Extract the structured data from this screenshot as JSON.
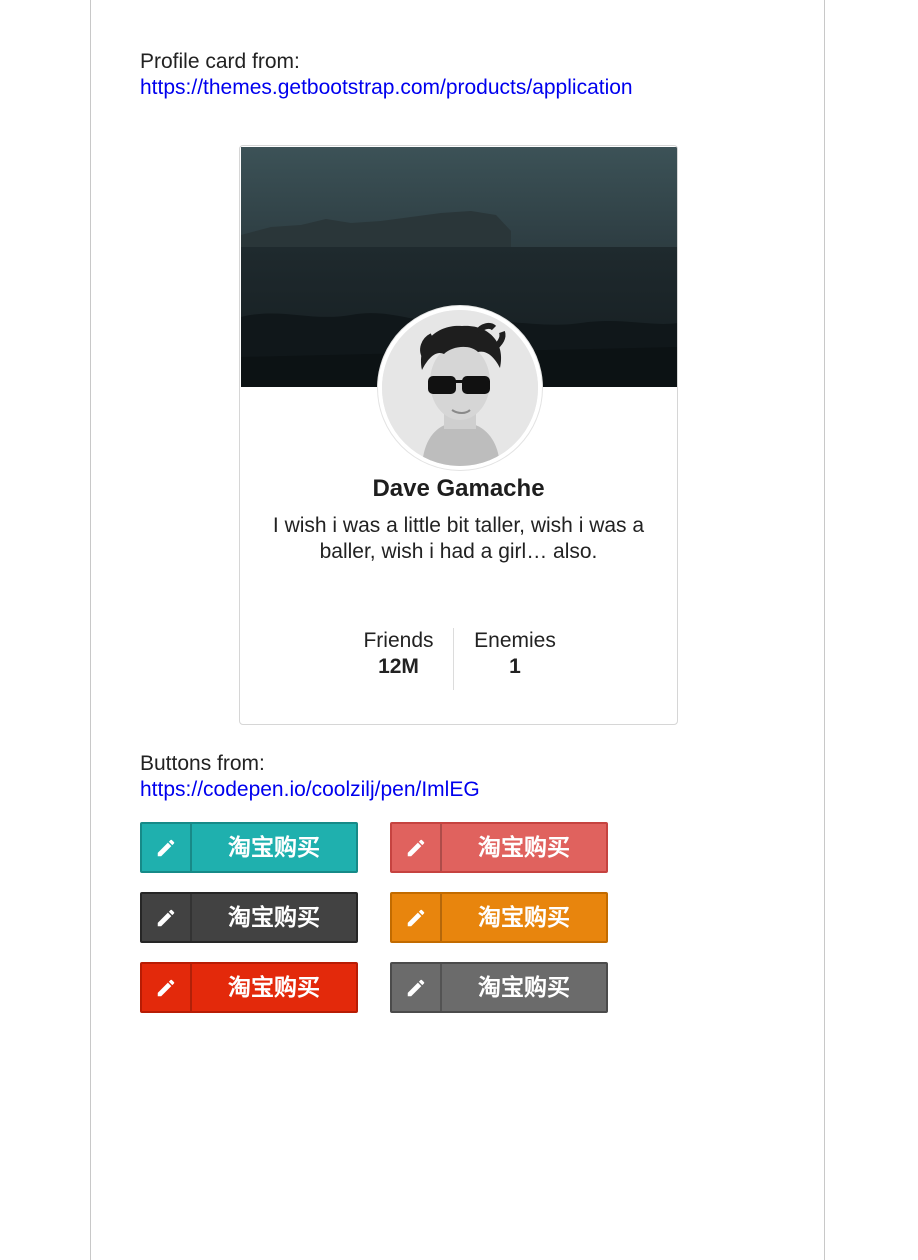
{
  "profile_intro": {
    "label": "Profile card from:",
    "link": "https://themes.getbootstrap.com/products/application"
  },
  "card": {
    "name": "Dave Gamache",
    "bio": "I wish i was a little bit taller, wish i was a baller, wish i had a girl… also.",
    "stats": [
      {
        "label": "Friends",
        "value": "12M"
      },
      {
        "label": "Enemies",
        "value": "1"
      }
    ]
  },
  "buttons_intro": {
    "label": "Buttons from:",
    "link": "https://codepen.io/coolzilj/pen/ImlEG"
  },
  "buttons": [
    {
      "label": "淘宝购买",
      "icon": "pencil-icon",
      "color": "#1fb0ae",
      "border": "#168a88"
    },
    {
      "label": "淘宝购买",
      "icon": "pencil-icon",
      "color": "#e0625e",
      "border": "#c64340"
    },
    {
      "label": "淘宝购买",
      "icon": "pencil-icon",
      "color": "#424242",
      "border": "#262626"
    },
    {
      "label": "淘宝购买",
      "icon": "pencil-icon",
      "color": "#e8850d",
      "border": "#c26b00"
    },
    {
      "label": "淘宝购买",
      "icon": "pencil-icon",
      "color": "#e3290b",
      "border": "#b81c04"
    },
    {
      "label": "淘宝购买",
      "icon": "pencil-icon",
      "color": "#6b6b6b",
      "border": "#4b4b4b"
    }
  ]
}
